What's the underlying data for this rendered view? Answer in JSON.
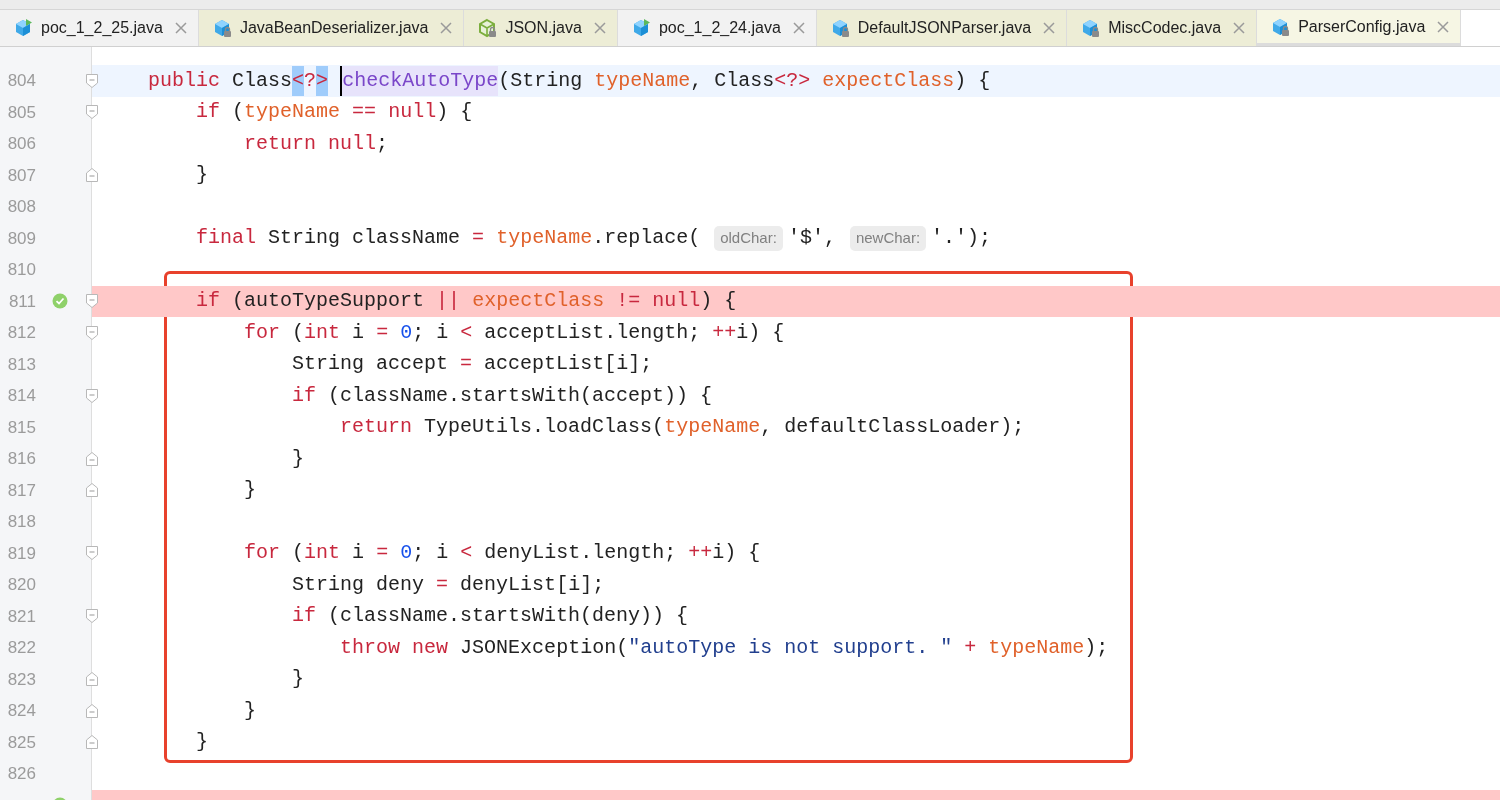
{
  "tabs": [
    {
      "label": "poc_1_2_25.java",
      "kind": "runnable",
      "selected": false
    },
    {
      "label": "JavaBeanDeserializer.java",
      "kind": "library",
      "selected": false
    },
    {
      "label": "JSON.java",
      "kind": "library-outline",
      "selected": false
    },
    {
      "label": "poc_1_2_24.java",
      "kind": "runnable",
      "selected": false
    },
    {
      "label": "DefaultJSONParser.java",
      "kind": "library",
      "selected": false
    },
    {
      "label": "MiscCodec.java",
      "kind": "library",
      "selected": false
    },
    {
      "label": "ParserConfig.java",
      "kind": "library",
      "selected": true
    }
  ],
  "editor": {
    "lines": [
      {
        "number": "804",
        "current": true,
        "fold_start": true,
        "tokens": [
          {
            "kind": "keyword",
            "text": "    public"
          },
          {
            "kind": "plain",
            "text": " Class"
          },
          {
            "kind": "match",
            "text": "<"
          },
          {
            "kind": "keyword",
            "text": "?"
          },
          {
            "kind": "match",
            "text": ">"
          },
          {
            "kind": "method",
            "text": " checkAutoType",
            "caret": true
          },
          {
            "kind": "plain",
            "text": "(String"
          },
          {
            "kind": "field",
            "text": " typeName"
          },
          {
            "kind": "plain",
            "text": ", Class"
          },
          {
            "kind": "keyword",
            "text": "<?>"
          },
          {
            "kind": "field",
            "text": " expectClass"
          },
          {
            "kind": "plain",
            "text": ") {"
          }
        ]
      },
      {
        "number": "805",
        "fold_start": true,
        "tokens": [
          {
            "kind": "keyword",
            "text": "        if"
          },
          {
            "kind": "plain",
            "text": " ("
          },
          {
            "kind": "field",
            "text": "typeName"
          },
          {
            "kind": "keyword",
            "text": " =="
          },
          {
            "kind": "keyword",
            "text": " null"
          },
          {
            "kind": "plain",
            "text": ") {"
          }
        ]
      },
      {
        "number": "806",
        "tokens": [
          {
            "kind": "keyword",
            "text": "            return"
          },
          {
            "kind": "keyword",
            "text": " null"
          },
          {
            "kind": "plain",
            "text": ";"
          }
        ]
      },
      {
        "number": "807",
        "fold_end": true,
        "tokens": [
          {
            "kind": "plain",
            "text": "        }"
          }
        ]
      },
      {
        "number": "808"
      },
      {
        "number": "809",
        "tokens": [
          {
            "kind": "keyword",
            "text": "        final"
          },
          {
            "kind": "plain",
            "text": " String className"
          },
          {
            "kind": "keyword",
            "text": " ="
          },
          {
            "kind": "field",
            "text": " typeName"
          },
          {
            "kind": "plain",
            "text": ".replace("
          },
          {
            "kind": "hint",
            "text": "oldChar:"
          },
          {
            "kind": "plain",
            "text": "'$',"
          },
          {
            "kind": "hint",
            "text": "newChar:"
          },
          {
            "kind": "plain",
            "text": "'.');"
          }
        ]
      },
      {
        "number": "810"
      },
      {
        "number": "811",
        "highlighted": true,
        "framed": true,
        "breakpoint": true,
        "fold_start": true,
        "tokens": [
          {
            "kind": "keyword",
            "text": "        if"
          },
          {
            "kind": "plain",
            "text": " (autoTypeSupport"
          },
          {
            "kind": "keyword",
            "text": " ||"
          },
          {
            "kind": "field",
            "text": " expectClass"
          },
          {
            "kind": "keyword",
            "text": " !="
          },
          {
            "kind": "keyword",
            "text": " null"
          },
          {
            "kind": "plain",
            "text": ") {"
          }
        ]
      },
      {
        "number": "812",
        "framed": true,
        "fold_start": true,
        "tokens": [
          {
            "kind": "keyword",
            "text": "            for"
          },
          {
            "kind": "plain",
            "text": " ("
          },
          {
            "kind": "keyword",
            "text": "int"
          },
          {
            "kind": "plain",
            "text": " i"
          },
          {
            "kind": "keyword",
            "text": " ="
          },
          {
            "kind": "number",
            "text": " 0"
          },
          {
            "kind": "plain",
            "text": "; i"
          },
          {
            "kind": "keyword",
            "text": " <"
          },
          {
            "kind": "plain",
            "text": " acceptList.length;"
          },
          {
            "kind": "keyword",
            "text": " ++"
          },
          {
            "kind": "plain",
            "text": "i) {"
          }
        ]
      },
      {
        "number": "813",
        "framed": true,
        "tokens": [
          {
            "kind": "plain",
            "text": "                String accept"
          },
          {
            "kind": "keyword",
            "text": " ="
          },
          {
            "kind": "plain",
            "text": " acceptList[i];"
          }
        ]
      },
      {
        "number": "814",
        "framed": true,
        "fold_start": true,
        "tokens": [
          {
            "kind": "keyword",
            "text": "                if"
          },
          {
            "kind": "plain",
            "text": " (className.startsWith(accept)) {"
          }
        ]
      },
      {
        "number": "815",
        "framed": true,
        "tokens": [
          {
            "kind": "keyword",
            "text": "                    return"
          },
          {
            "kind": "plain",
            "text": " TypeUtils.loadClass("
          },
          {
            "kind": "field",
            "text": "typeName"
          },
          {
            "kind": "plain",
            "text": ", defaultClassLoader);"
          }
        ]
      },
      {
        "number": "816",
        "framed": true,
        "fold_end": true,
        "tokens": [
          {
            "kind": "plain",
            "text": "                }"
          }
        ]
      },
      {
        "number": "817",
        "framed": true,
        "fold_end": true,
        "tokens": [
          {
            "kind": "plain",
            "text": "            }"
          }
        ]
      },
      {
        "number": "818",
        "framed": true
      },
      {
        "number": "819",
        "framed": true,
        "fold_start": true,
        "tokens": [
          {
            "kind": "keyword",
            "text": "            for"
          },
          {
            "kind": "plain",
            "text": " ("
          },
          {
            "kind": "keyword",
            "text": "int"
          },
          {
            "kind": "plain",
            "text": " i"
          },
          {
            "kind": "keyword",
            "text": " ="
          },
          {
            "kind": "number",
            "text": " 0"
          },
          {
            "kind": "plain",
            "text": "; i"
          },
          {
            "kind": "keyword",
            "text": " <"
          },
          {
            "kind": "plain",
            "text": " denyList.length;"
          },
          {
            "kind": "keyword",
            "text": " ++"
          },
          {
            "kind": "plain",
            "text": "i) {"
          }
        ]
      },
      {
        "number": "820",
        "framed": true,
        "tokens": [
          {
            "kind": "plain",
            "text": "                String deny"
          },
          {
            "kind": "keyword",
            "text": " ="
          },
          {
            "kind": "plain",
            "text": " denyList[i];"
          }
        ]
      },
      {
        "number": "821",
        "framed": true,
        "fold_start": true,
        "tokens": [
          {
            "kind": "keyword",
            "text": "                if"
          },
          {
            "kind": "plain",
            "text": " (className.startsWith(deny)) {"
          }
        ]
      },
      {
        "number": "822",
        "framed": true,
        "tokens": [
          {
            "kind": "keyword",
            "text": "                    throw"
          },
          {
            "kind": "keyword",
            "text": " new"
          },
          {
            "kind": "plain",
            "text": " JSONException("
          },
          {
            "kind": "string",
            "text": "\"autoType is not support. \""
          },
          {
            "kind": "keyword",
            "text": " +"
          },
          {
            "kind": "field",
            "text": " typeName"
          },
          {
            "kind": "plain",
            "text": ");"
          }
        ]
      },
      {
        "number": "823",
        "framed": true,
        "fold_end": true,
        "tokens": [
          {
            "kind": "plain",
            "text": "                }"
          }
        ]
      },
      {
        "number": "824",
        "framed": true,
        "fold_end": true,
        "tokens": [
          {
            "kind": "plain",
            "text": "            }"
          }
        ]
      },
      {
        "number": "825",
        "framed": true,
        "fold_end": true,
        "tokens": [
          {
            "kind": "plain",
            "text": "        }"
          }
        ]
      },
      {
        "number": "826"
      }
    ],
    "next_line": {
      "highlighted": true,
      "breakpoint": true
    }
  }
}
